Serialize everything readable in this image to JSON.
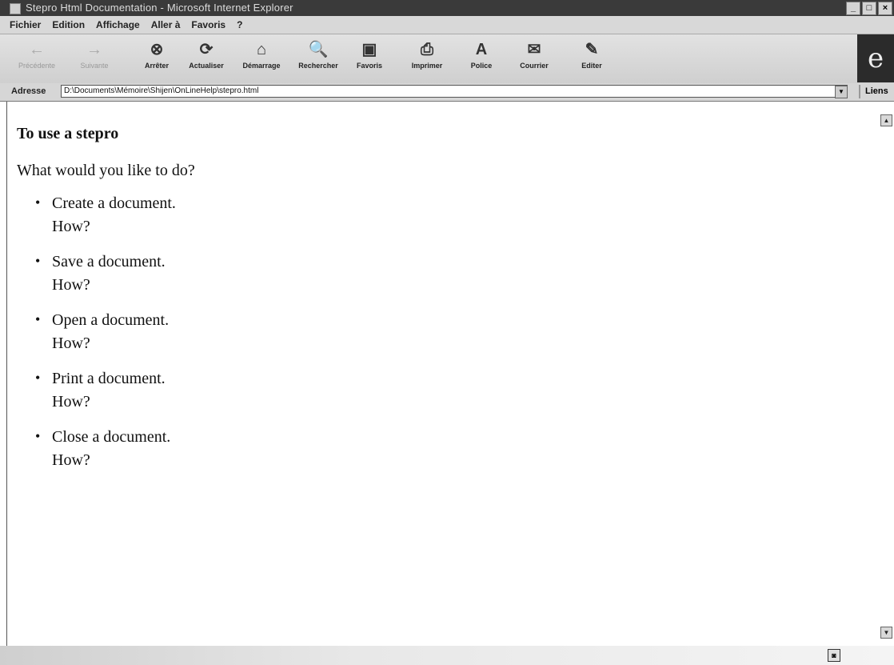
{
  "window": {
    "title": "Stepro Html Documentation - Microsoft Internet Explorer",
    "buttons": [
      "_",
      "□",
      "×"
    ]
  },
  "menubar": [
    "Fichier",
    "Edition",
    "Affichage",
    "Aller à",
    "Favoris",
    "?"
  ],
  "toolbar": [
    {
      "label": "Précédente",
      "icon": "←",
      "enabled": false
    },
    {
      "label": "Suivante",
      "icon": "→",
      "enabled": false
    },
    {
      "label": "Arrêter",
      "icon": "⊗",
      "enabled": true
    },
    {
      "label": "Actualiser",
      "icon": "⟳",
      "enabled": true
    },
    {
      "label": "Démarrage",
      "icon": "⌂",
      "enabled": true
    },
    {
      "label": "Rechercher",
      "icon": "🔍",
      "enabled": true
    },
    {
      "label": "Favoris",
      "icon": "▣",
      "enabled": true
    },
    {
      "label": "Imprimer",
      "icon": "⎙",
      "enabled": true
    },
    {
      "label": "Police",
      "icon": "A",
      "enabled": true
    },
    {
      "label": "Courrier",
      "icon": "✉",
      "enabled": true
    },
    {
      "label": "Editer",
      "icon": "✎",
      "enabled": true
    }
  ],
  "address": {
    "label": "Adresse",
    "value": "D:\\Documents\\Mémoire\\Shijen\\OnLineHelp\\stepro.html",
    "links_label": "Liens"
  },
  "page": {
    "heading": "To use a stepro",
    "intro": "What would you like to do?",
    "bullet": "•",
    "tasks": [
      {
        "task": "Create a document.",
        "how": "How?"
      },
      {
        "task": "Save a document.",
        "how": "How?"
      },
      {
        "task": "Open a document.",
        "how": "How?"
      },
      {
        "task": "Print a document.",
        "how": "How?"
      },
      {
        "task": "Close a document.",
        "how": "How?"
      }
    ]
  },
  "status": {
    "text": "",
    "zone_icon": "◙"
  }
}
